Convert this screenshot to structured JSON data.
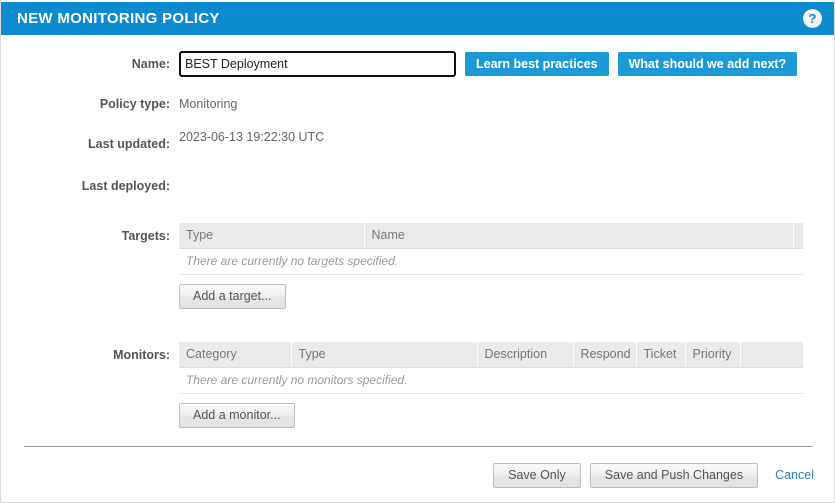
{
  "window": {
    "title": "NEW MONITORING POLICY",
    "help_icon": "question-mark-icon",
    "help_glyph": "?",
    "accent_color": "#0d8bd0",
    "link_color": "#2a7fc9"
  },
  "form": {
    "name": {
      "label": "Name:",
      "value": "BEST Deployment",
      "placeholder": ""
    },
    "buttons": {
      "learn_best_practices": "Learn best practices",
      "what_should_we_add_next": "What should we add next?"
    },
    "policy_type": {
      "label": "Policy type:",
      "value": "Monitoring"
    },
    "last_updated": {
      "label": "Last updated:",
      "value": "2023-06-13 19:22:30 UTC"
    },
    "last_deployed": {
      "label": "Last deployed:",
      "value": ""
    }
  },
  "targets": {
    "label": "Targets:",
    "columns": [
      "Type",
      "Name",
      ""
    ],
    "rows": [],
    "empty_message": "There are currently no targets specified.",
    "add_button": "Add a target..."
  },
  "monitors": {
    "label": "Monitors:",
    "columns": [
      "Category",
      "Type",
      "Description",
      "Respond",
      "Ticket",
      "Priority",
      ""
    ],
    "rows": [],
    "empty_message": "There are currently no monitors specified.",
    "add_button": "Add a monitor..."
  },
  "footer": {
    "save_only": "Save Only",
    "save_and_push": "Save and Push Changes",
    "cancel": "Cancel"
  }
}
